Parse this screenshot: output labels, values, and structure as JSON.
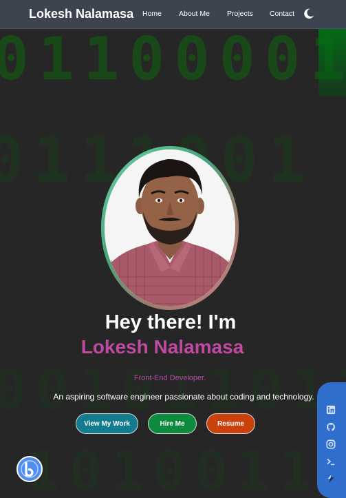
{
  "nav": {
    "brand": "Lokesh Nalamasa",
    "links": [
      "Home",
      "About Me",
      "Projects",
      "Contact"
    ],
    "theme_toggle_icon": "moon-icon"
  },
  "hero": {
    "greeting": "Hey there! I'm",
    "name": "Lokesh Nalamasa",
    "role": "Front-End Developer.",
    "tagline": "An aspiring software engineer passionate about coding and technology.",
    "photo_icon": "profile-photo"
  },
  "buttons": {
    "work": "View My Work",
    "hire": "Hire Me",
    "resume": "Resume"
  },
  "social": {
    "icons": [
      "linkedin-icon",
      "github-icon",
      "instagram-icon",
      "terminal-icon",
      "layers-icon"
    ]
  },
  "floating_button_icon": "b-logo-icon",
  "colors": {
    "navbar": "#3d4450",
    "background": "#262626",
    "name_accent": "#c049a2",
    "role_text": "#b24ca5",
    "view_work_button": "#127c8e",
    "hire_button": "#0e8a3f",
    "resume_button": "#c9410b",
    "social_bar": "#2f6ecc",
    "fab": "#4d8ef0"
  }
}
